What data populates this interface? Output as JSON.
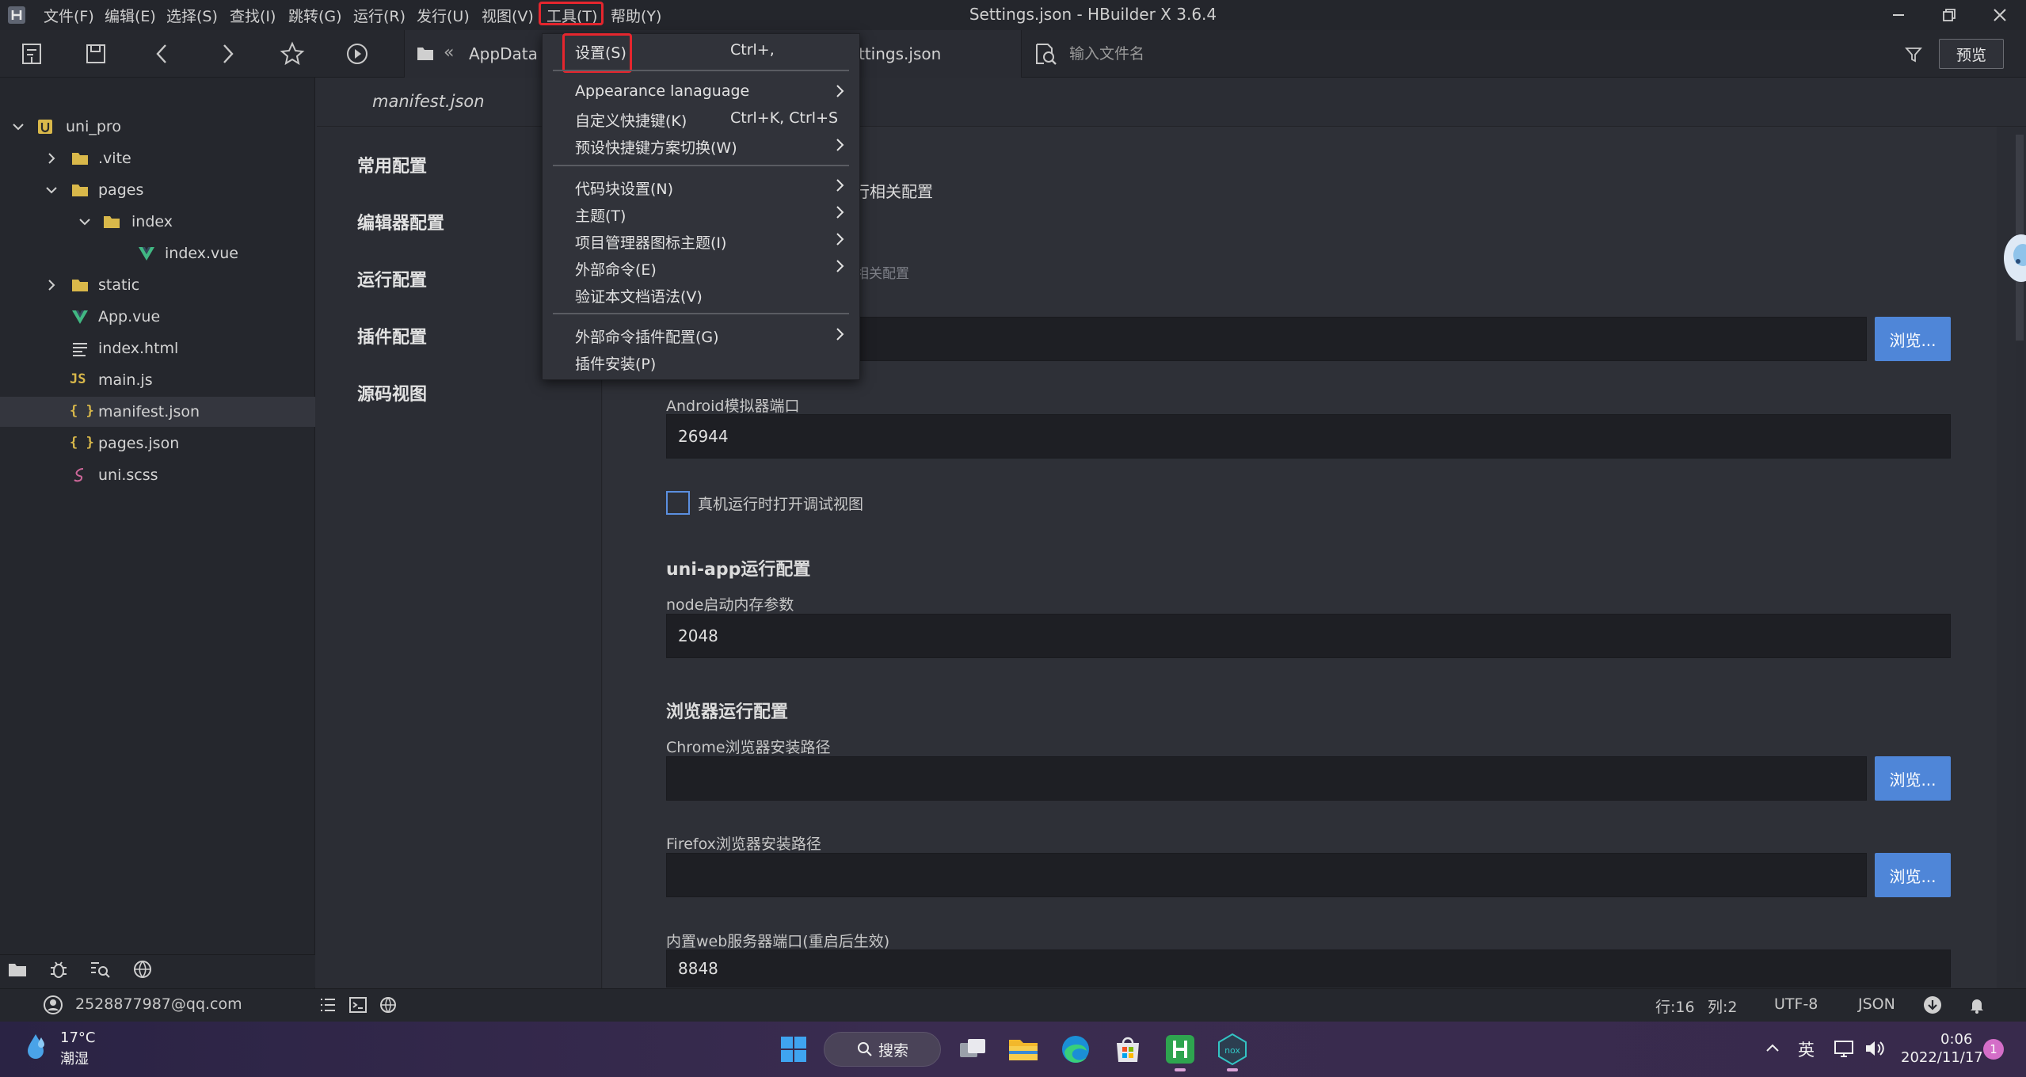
{
  "menubar": {
    "items": [
      "文件(F)",
      "编辑(E)",
      "选择(S)",
      "查找(I)",
      "跳转(G)",
      "运行(R)",
      "发行(U)",
      "视图(V)",
      "工具(T)",
      "帮助(Y)"
    ],
    "window_title": "Settings.json - HBuilder X 3.6.4"
  },
  "toolbar": {
    "icons": [
      "new-file-icon",
      "save-icon",
      "back-icon",
      "forward-icon",
      "bookmark-star-icon",
      "run-icon"
    ],
    "breadcrumb": {
      "separator": "«",
      "folder": "AppData",
      "file": "ttings.json"
    },
    "search_placeholder": "输入文件名",
    "preview_label": "预览"
  },
  "file_tree": {
    "items": [
      {
        "label": "uni_pro",
        "icon": "project-icon",
        "expanded": true
      },
      {
        "label": ".vite",
        "icon": "folder-icon",
        "expanded": false
      },
      {
        "label": "pages",
        "icon": "folder-icon",
        "expanded": true
      },
      {
        "label": "index",
        "icon": "folder-icon",
        "expanded": true
      },
      {
        "label": "index.vue",
        "icon": "vue-icon"
      },
      {
        "label": "static",
        "icon": "folder-icon",
        "expanded": false
      },
      {
        "label": "App.vue",
        "icon": "vue-icon"
      },
      {
        "label": "index.html",
        "icon": "html-icon"
      },
      {
        "label": "main.js",
        "icon": "js-icon",
        "icon_text": "JS"
      },
      {
        "label": "manifest.json",
        "icon": "json-icon",
        "icon_text": "{ }",
        "selected": true
      },
      {
        "label": "pages.json",
        "icon": "json-icon",
        "icon_text": "{ }"
      },
      {
        "label": "uni.scss",
        "icon": "scss-icon"
      }
    ]
  },
  "editor": {
    "tab_label": "manifest.json",
    "settings_nav": [
      "常用配置",
      "编辑器配置",
      "运行配置",
      "插件配置",
      "源码视图"
    ],
    "partial_heading": "行相关配置",
    "partial_subheading": "相关配置",
    "android_port_label": "Android模拟器端口",
    "android_port_value": "26944",
    "debug_checkbox_label": "真机运行时打开调试视图",
    "uniapp_section": "uni-app运行配置",
    "node_mem_label": "node启动内存参数",
    "node_mem_value": "2048",
    "browser_section": "浏览器运行配置",
    "chrome_label": "Chrome浏览器安装路径",
    "chrome_value": "",
    "firefox_label": "Firefox浏览器安装路径",
    "firefox_value": "",
    "web_port_label": "内置web服务器端口(重启后生效)",
    "web_port_value": "8848",
    "browse_label": "浏览..."
  },
  "tools_menu": {
    "items": [
      {
        "label": "设置(S)",
        "shortcut": "Ctrl+,",
        "submenu": false
      },
      {
        "label": "Appearance lanaguage",
        "shortcut": "",
        "submenu": true
      },
      {
        "label": "自定义快捷键(K)",
        "shortcut": "Ctrl+K, Ctrl+S",
        "submenu": false
      },
      {
        "label": "预设快捷键方案切换(W)",
        "shortcut": "",
        "submenu": true
      },
      {
        "label": "代码块设置(N)",
        "shortcut": "",
        "submenu": true
      },
      {
        "label": "主题(T)",
        "shortcut": "",
        "submenu": true
      },
      {
        "label": "项目管理器图标主题(I)",
        "shortcut": "",
        "submenu": true
      },
      {
        "label": "外部命令(E)",
        "shortcut": "",
        "submenu": true
      },
      {
        "label": "验证本文档语法(V)",
        "shortcut": "",
        "submenu": false
      },
      {
        "label": "外部命令插件配置(G)",
        "shortcut": "",
        "submenu": true
      },
      {
        "label": "插件安装(P)",
        "shortcut": "",
        "submenu": false
      }
    ]
  },
  "statusbar": {
    "user": "2528877987@qq.com",
    "line": "行:16",
    "col": "列:2",
    "encoding": "UTF-8",
    "language": "JSON"
  },
  "taskbar": {
    "weather_temp": "17°C",
    "weather_desc": "潮湿",
    "search_label": "搜索",
    "ime": "英",
    "time": "0:06",
    "date": "2022/11/17",
    "notification_count": "1"
  },
  "colors": {
    "accent_blue": "#4f86d8",
    "highlight_red": "#e5262e",
    "vue_green": "#41b883",
    "json_yellow": "#d9b84a"
  }
}
